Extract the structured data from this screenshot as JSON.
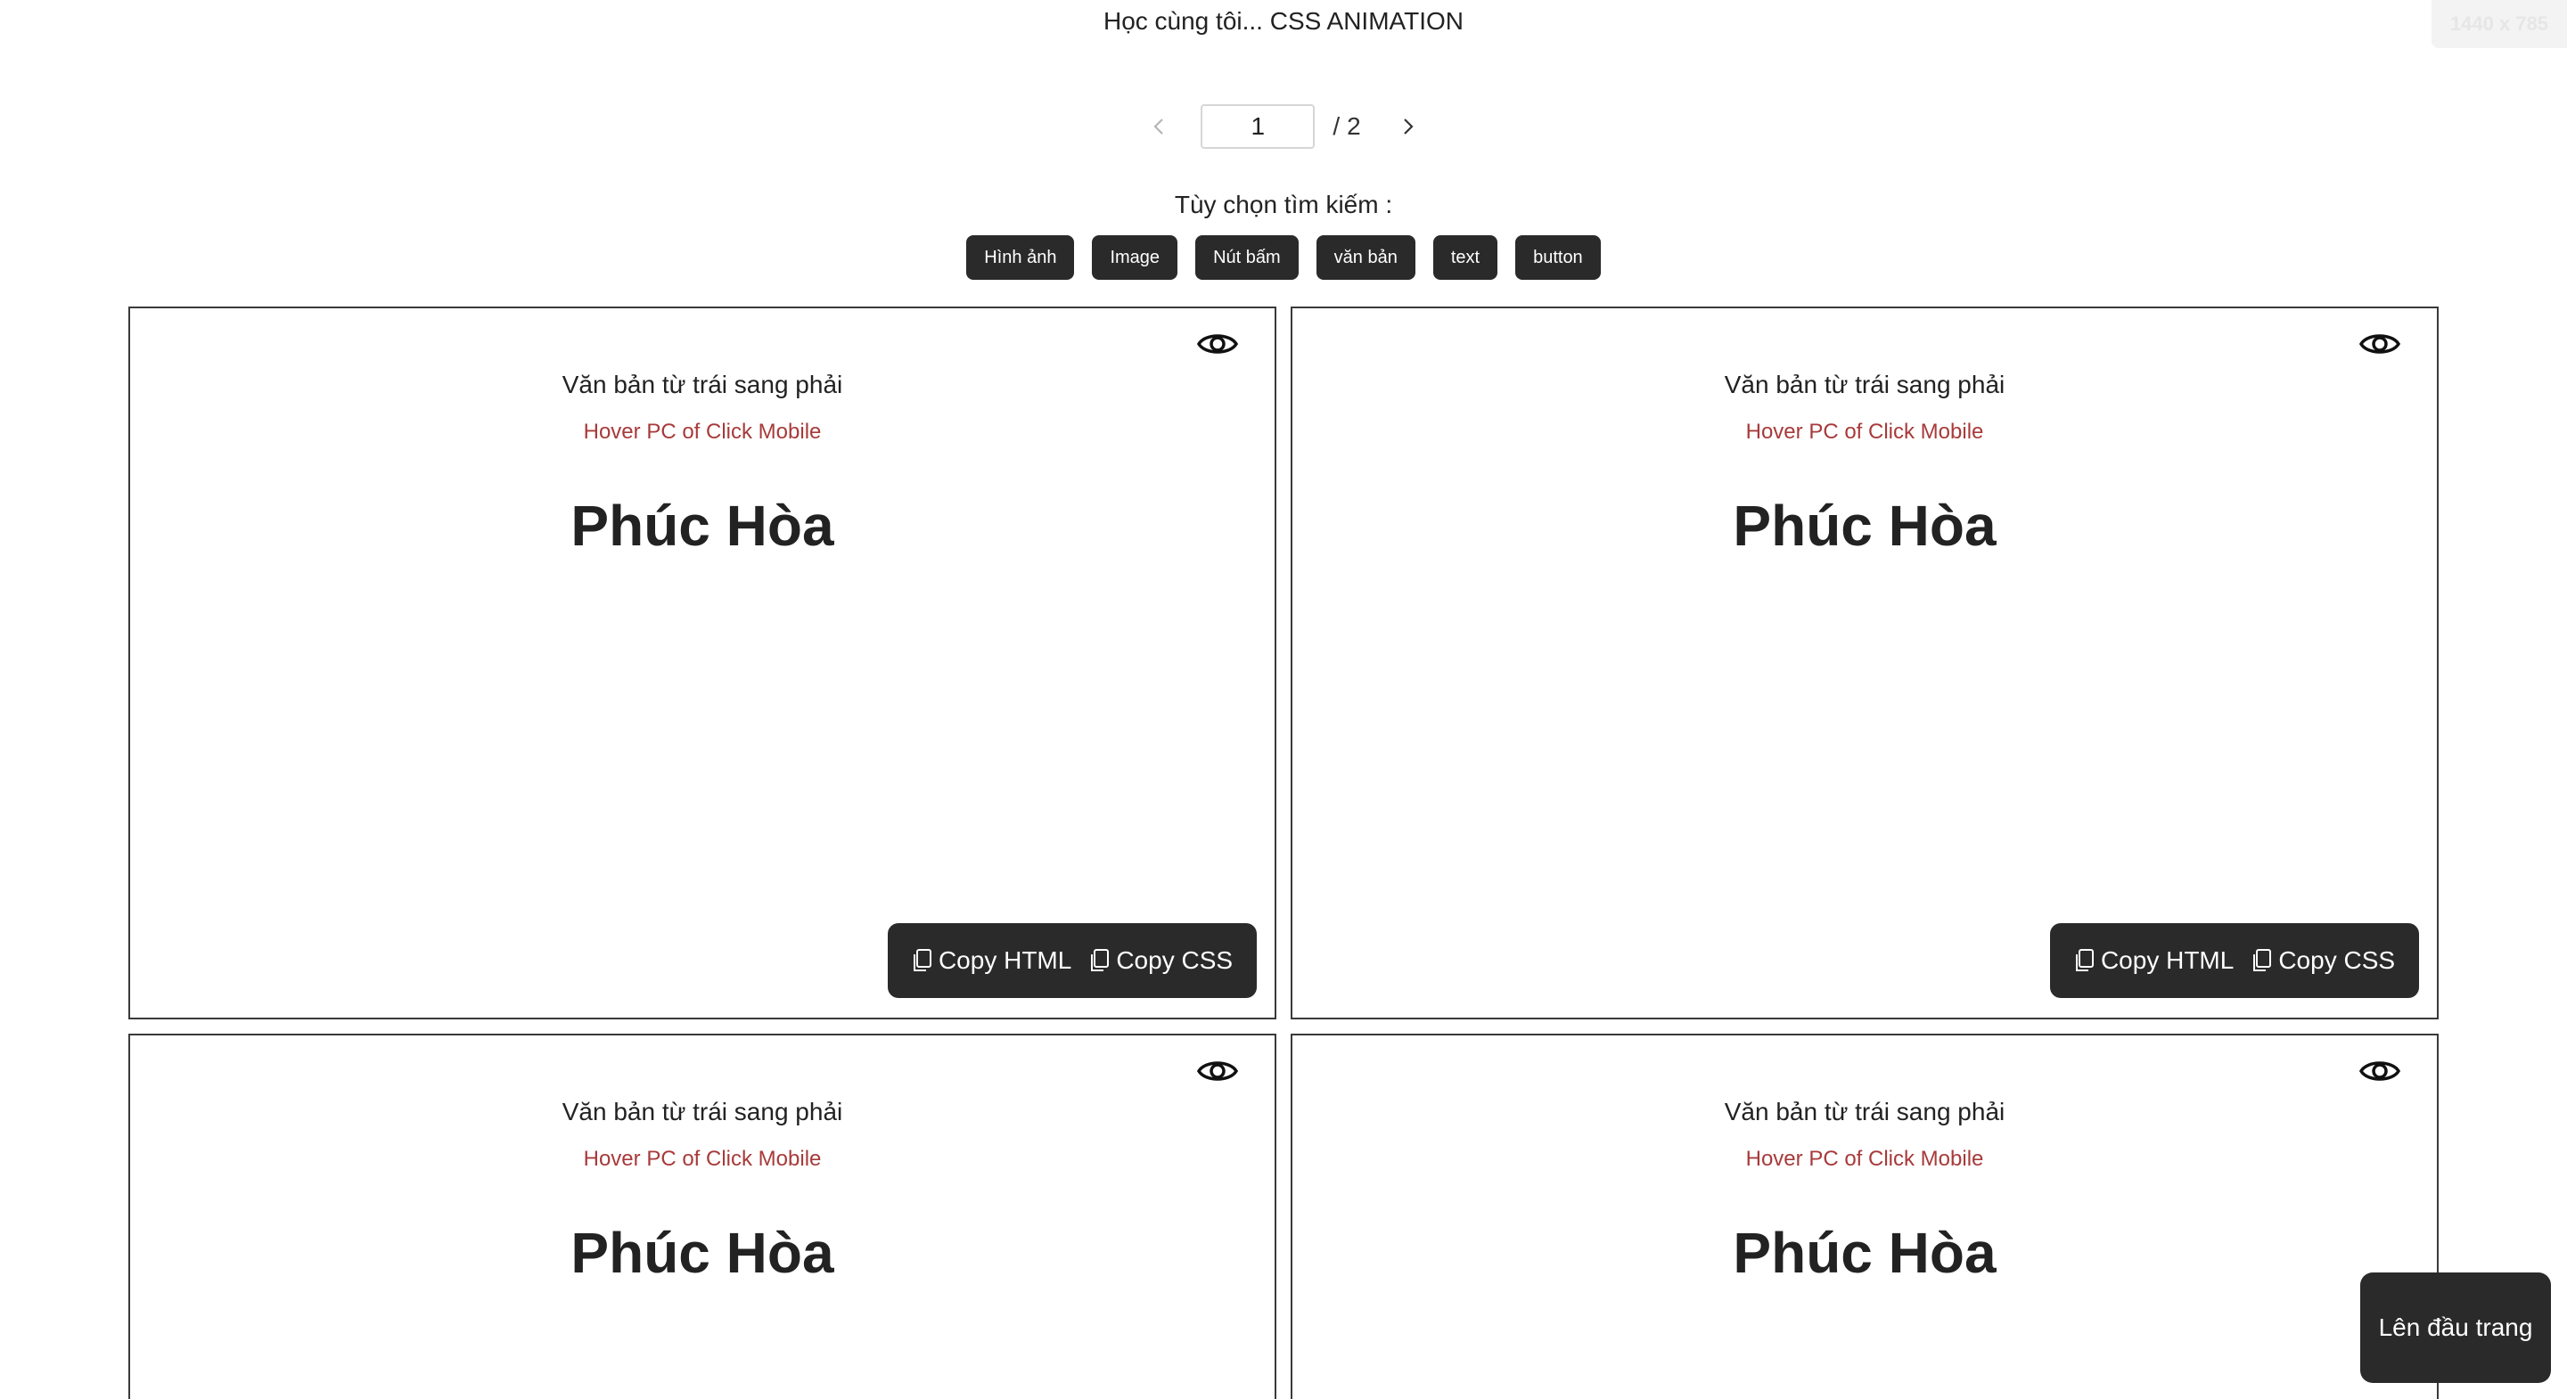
{
  "header": {
    "title": "Học cùng tôi... CSS ANIMATION",
    "size_badge": "1440 x 785"
  },
  "pagination": {
    "current_page": "1",
    "separator": "/",
    "total_pages": "2"
  },
  "filters": {
    "label": "Tùy chọn tìm kiếm :",
    "options": [
      "Hình ảnh",
      "Image",
      "Nút bấm",
      "văn bản",
      "text",
      "button"
    ]
  },
  "cards": [
    {
      "title": "Văn bản từ trái sang phải",
      "subtitle": "Hover PC of Click Mobile",
      "name": "Phúc Hòa",
      "copy_html": "Copy HTML",
      "copy_css": "Copy CSS"
    },
    {
      "title": "Văn bản từ trái sang phải",
      "subtitle": "Hover PC of Click Mobile",
      "name": "Phúc Hòa",
      "copy_html": "Copy HTML",
      "copy_css": "Copy CSS"
    },
    {
      "title": "Văn bản từ trái sang phải",
      "subtitle": "Hover PC of Click Mobile",
      "name": "Phúc Hòa"
    },
    {
      "title": "Văn bản từ trái sang phải",
      "subtitle": "Hover PC of Click Mobile",
      "name": "Phúc Hòa"
    }
  ],
  "back_to_top": "Lên đầu trang",
  "colors": {
    "dark_button": "#2a2a2a",
    "subtitle_red": "#a83a3a",
    "card_border": "#3a3a3a"
  },
  "icons": {
    "prev": "chevron-left-icon",
    "next": "chevron-right-icon",
    "preview": "eye-icon",
    "copy": "copy-icon"
  }
}
